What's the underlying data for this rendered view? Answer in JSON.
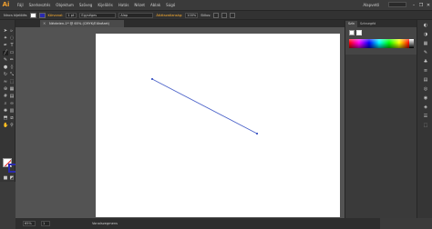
{
  "app": {
    "logo": "Ai"
  },
  "menu": {
    "items": [
      "Fájl",
      "Szerkesztés",
      "Objektum",
      "Szöveg",
      "Kijelölés",
      "Hatás",
      "Nézet",
      "Ablak",
      "Súgó"
    ],
    "workspace": "Alapvető",
    "window_buttons": [
      "–",
      "❐",
      "✕"
    ]
  },
  "control_bar": {
    "selection_label": "Nincs kijelölés",
    "stroke_label": "Körvonal:",
    "stroke_value": "1 pt",
    "profile_label": "Egységes",
    "brush_label": "Alap",
    "opacity_label": "Átlátszatlanság:",
    "opacity_value": "100%",
    "style_label": "Stílus:"
  },
  "document": {
    "tab_title": "Névtelen-1* @ 65% (CMYK/Előnézet)",
    "close_glyph": "×"
  },
  "status_bar": {
    "zoom": "65%",
    "page": "1",
    "tool_status": "Vonalszegmens"
  },
  "panels": {
    "tabs": [
      "Szín",
      "Színsegéd"
    ]
  },
  "colors": {
    "stroke_blue": "#2a2ab0",
    "line_color": "#4c63c9",
    "canvas_bg": "#535353",
    "artboard": "#ffffff"
  },
  "icons": {
    "tools": [
      "selection-tool-icon",
      "direct-selection-tool-icon",
      "magic-wand-icon",
      "lasso-icon",
      "pen-tool-icon",
      "type-tool-icon",
      "line-segment-tool-icon",
      "rectangle-tool-icon",
      "paintbrush-icon",
      "pencil-icon",
      "blob-brush-icon",
      "eraser-icon",
      "rotate-icon",
      "scale-icon",
      "warp-icon",
      "free-transform-icon",
      "shape-builder-icon",
      "perspective-grid-icon",
      "mesh-icon",
      "gradient-icon",
      "eyedropper-icon",
      "blend-icon",
      "symbol-sprayer-icon",
      "column-graph-icon",
      "artboard-tool-icon",
      "slice-icon",
      "hand-tool-icon",
      "zoom-tool-icon"
    ],
    "side_panel": [
      "color-panel-icon",
      "color-guide-icon",
      "swatches-icon",
      "brushes-icon",
      "symbols-icon",
      "stroke-icon",
      "gradient-panel-icon",
      "transparency-icon",
      "appearance-icon",
      "graphic-styles-icon",
      "layers-icon",
      "artboards-icon"
    ]
  }
}
